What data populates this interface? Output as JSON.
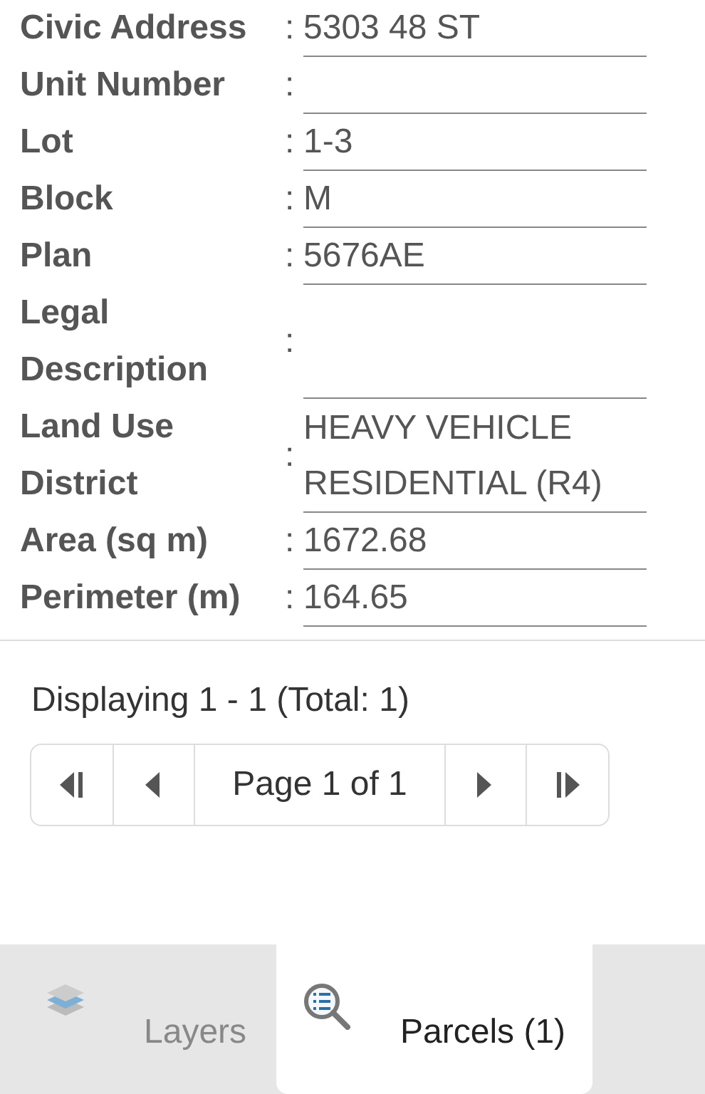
{
  "attributes": [
    {
      "label": "Civic Address",
      "colon": ":",
      "value": "5303 48 ST"
    },
    {
      "label": "Unit Number",
      "colon": ":"
    },
    {
      "label": "Lot",
      "colon": ":",
      "value": "1-3"
    },
    {
      "label": "Block",
      "colon": ":",
      "value": "M"
    },
    {
      "label": "Plan",
      "colon": ":",
      "value": "5676AE"
    },
    {
      "label": "Legal Description",
      "colon": ":"
    },
    {
      "label": "Land Use District",
      "colon": ":",
      "value": "HEAVY VEHICLE RESIDENTIAL (R4)"
    },
    {
      "label": "Area (sq m)",
      "colon": ":",
      "value": "1672.68"
    },
    {
      "label": "Perimeter (m)",
      "colon": ":",
      "value": "164.65"
    }
  ],
  "summary": "Displaying 1 - 1 (Total: 1)",
  "pager": {
    "page_label": "Page 1 of 1"
  },
  "tabs": [
    {
      "label": "Layers",
      "selected": false
    },
    {
      "label": "Parcels (1)",
      "selected": true
    }
  ]
}
